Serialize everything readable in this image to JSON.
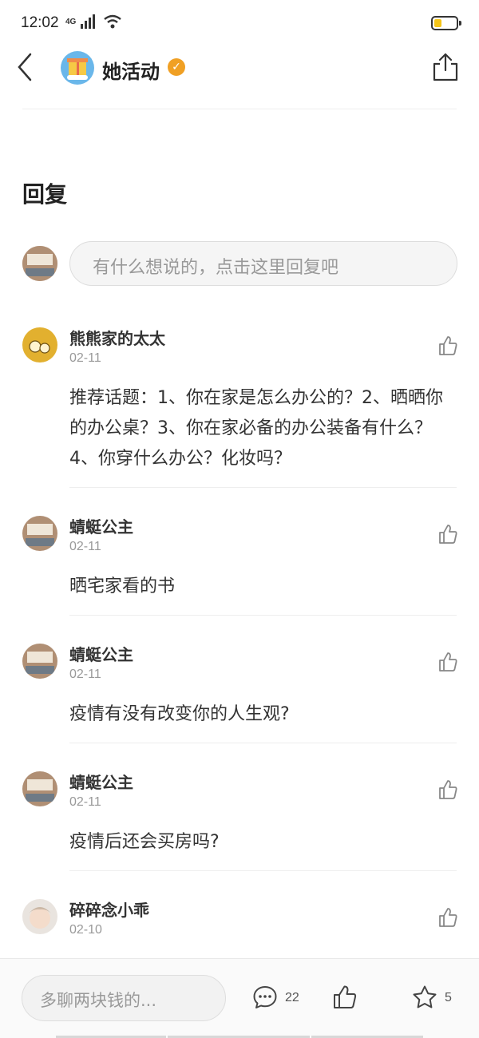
{
  "status_bar": {
    "time": "12:02",
    "network": "4G"
  },
  "header": {
    "title": "她活动"
  },
  "section": {
    "title": "回复"
  },
  "reply": {
    "placeholder": "有什么想说的，点击这里回复吧"
  },
  "comments": [
    {
      "name": "熊熊家的太太",
      "date": "02-11",
      "text": "推荐话题：1、你在家是怎么办公的？2、晒晒你的办公桌？3、你在家必备的办公装备有什么？4、你穿什么办公？化妆吗？"
    },
    {
      "name": "蜻蜓公主",
      "date": "02-11",
      "text": "晒宅家看的书"
    },
    {
      "name": "蜻蜓公主",
      "date": "02-11",
      "text": "疫情有没有改变你的人生观?"
    },
    {
      "name": "蜻蜓公主",
      "date": "02-11",
      "text": "疫情后还会买房吗?"
    },
    {
      "name": "碎碎念小乖",
      "date": "02-10",
      "text": ""
    }
  ],
  "bottom_bar": {
    "input_placeholder": "多聊两块钱的...",
    "comment_count": "22",
    "favorite_count": "5"
  },
  "icons": {
    "back": "chevron-left-icon",
    "share": "share-icon",
    "verified": "verified-badge-icon",
    "like": "thumbs-up-icon",
    "comment": "comment-bubble-icon",
    "favorite": "star-icon"
  },
  "colors": {
    "verified": "#f0a024",
    "placeholder": "#999999",
    "battery": "#f5c518"
  }
}
